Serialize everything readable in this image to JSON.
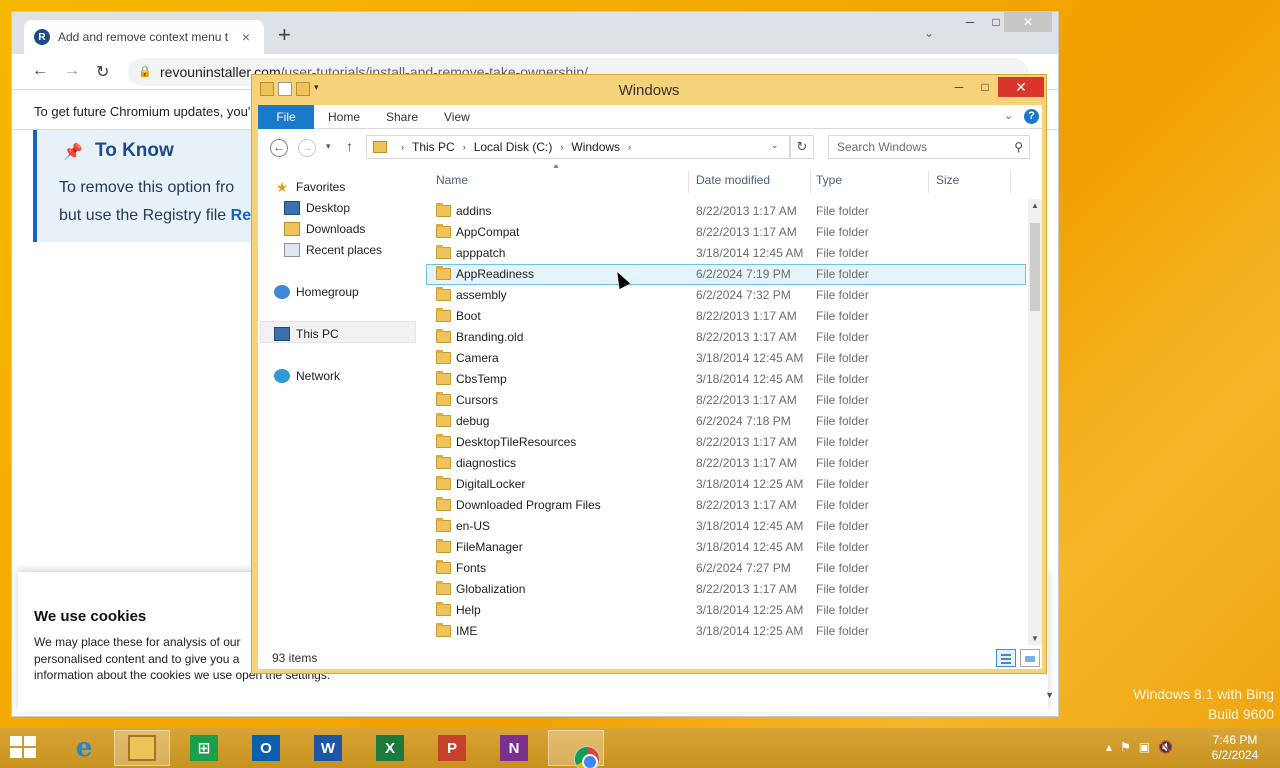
{
  "desktop": {
    "watermark_line1": "Windows 8.1 with Bing",
    "watermark_line2": "Build 9600"
  },
  "browser": {
    "tab_title": "Add and remove context menu t",
    "tab_favicon": "R",
    "url_domain": "revouninstaller.com",
    "url_path": "/user-tutorials/install-and-remove-take-ownership/",
    "infobar_text": "To get future Chromium updates, you'",
    "callout_heading": "To Know",
    "callout_line1": "To remove this option fro",
    "callout_line2_prefix": "but use the Registry file ",
    "callout_line2_link": "Re",
    "cookie_title": "We use cookies",
    "cookie_line1": "We may place these for analysis of our",
    "cookie_line2": "personalised content and to give you a",
    "cookie_line3": "information about the cookies we use open the settings."
  },
  "explorer": {
    "title": "Windows",
    "ribbon": {
      "file": "File",
      "home": "Home",
      "share": "Share",
      "view": "View",
      "help": "?"
    },
    "breadcrumb": [
      "This PC",
      "Local Disk (C:)",
      "Windows"
    ],
    "search_placeholder": "Search Windows",
    "nav": {
      "favorites": "Favorites",
      "desktop": "Desktop",
      "downloads": "Downloads",
      "recent": "Recent places",
      "homegroup": "Homegroup",
      "thispc": "This PC",
      "network": "Network"
    },
    "columns": {
      "name": "Name",
      "date": "Date modified",
      "type": "Type",
      "size": "Size"
    },
    "files": [
      {
        "name": "addins",
        "date": "8/22/2013 1:17 AM",
        "type": "File folder"
      },
      {
        "name": "AppCompat",
        "date": "8/22/2013 1:17 AM",
        "type": "File folder"
      },
      {
        "name": "apppatch",
        "date": "3/18/2014 12:45 AM",
        "type": "File folder"
      },
      {
        "name": "AppReadiness",
        "date": "6/2/2024 7:19 PM",
        "type": "File folder"
      },
      {
        "name": "assembly",
        "date": "6/2/2024 7:32 PM",
        "type": "File folder"
      },
      {
        "name": "Boot",
        "date": "8/22/2013 1:17 AM",
        "type": "File folder"
      },
      {
        "name": "Branding.old",
        "date": "8/22/2013 1:17 AM",
        "type": "File folder"
      },
      {
        "name": "Camera",
        "date": "3/18/2014 12:45 AM",
        "type": "File folder"
      },
      {
        "name": "CbsTemp",
        "date": "3/18/2014 12:45 AM",
        "type": "File folder"
      },
      {
        "name": "Cursors",
        "date": "8/22/2013 1:17 AM",
        "type": "File folder"
      },
      {
        "name": "debug",
        "date": "6/2/2024 7:18 PM",
        "type": "File folder"
      },
      {
        "name": "DesktopTileResources",
        "date": "8/22/2013 1:17 AM",
        "type": "File folder"
      },
      {
        "name": "diagnostics",
        "date": "8/22/2013 1:17 AM",
        "type": "File folder"
      },
      {
        "name": "DigitalLocker",
        "date": "3/18/2014 12:25 AM",
        "type": "File folder"
      },
      {
        "name": "Downloaded Program Files",
        "date": "8/22/2013 1:17 AM",
        "type": "File folder"
      },
      {
        "name": "en-US",
        "date": "3/18/2014 12:45 AM",
        "type": "File folder"
      },
      {
        "name": "FileManager",
        "date": "3/18/2014 12:45 AM",
        "type": "File folder"
      },
      {
        "name": "Fonts",
        "date": "6/2/2024 7:27 PM",
        "type": "File folder"
      },
      {
        "name": "Globalization",
        "date": "8/22/2013 1:17 AM",
        "type": "File folder"
      },
      {
        "name": "Help",
        "date": "3/18/2014 12:25 AM",
        "type": "File folder"
      },
      {
        "name": "IME",
        "date": "3/18/2014 12:25 AM",
        "type": "File folder"
      }
    ],
    "selected_index": 3,
    "status_count": "93 items"
  },
  "taskbar": {
    "clock_time": "7:46 PM",
    "clock_date": "6/2/2024",
    "apps": [
      {
        "name": "internet-explorer",
        "glyph": "e"
      },
      {
        "name": "file-explorer",
        "glyph": ""
      },
      {
        "name": "store",
        "glyph": "⊞"
      },
      {
        "name": "outlook",
        "glyph": "O"
      },
      {
        "name": "word",
        "glyph": "W"
      },
      {
        "name": "excel",
        "glyph": "X"
      },
      {
        "name": "powerpoint",
        "glyph": "P"
      },
      {
        "name": "onenote",
        "glyph": "N"
      },
      {
        "name": "chrome",
        "glyph": ""
      }
    ]
  }
}
